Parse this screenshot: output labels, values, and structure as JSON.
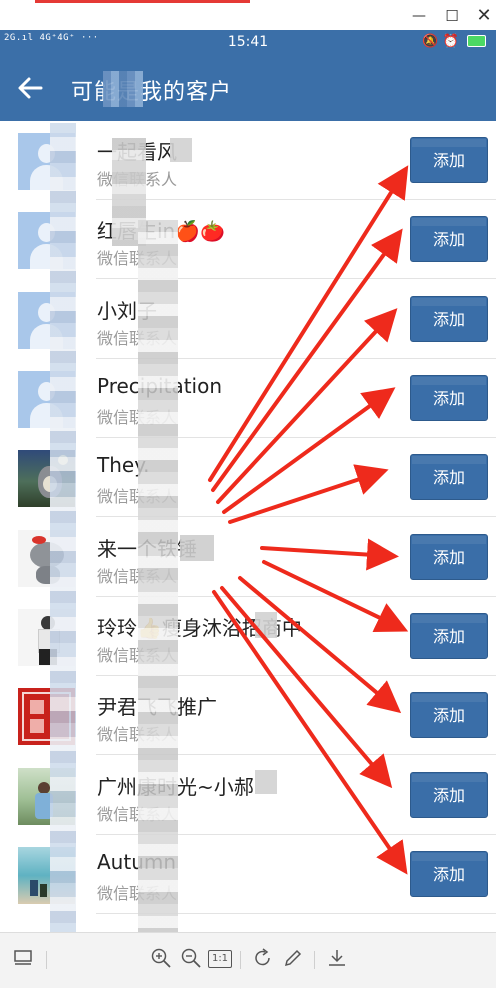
{
  "window": {
    "min_glyph": "—",
    "max_glyph": "☐",
    "close_glyph": "✕"
  },
  "status_bar": {
    "signal_text": "2G.ıl 4G⁺4G⁺ ···",
    "time": "15:41",
    "right_icons": "🔕 ⏰",
    "battery_level_percent": 90,
    "battery_color": "#4cd964"
  },
  "header": {
    "back_icon": "arrow-left-icon",
    "title": "可能是我的客户",
    "bg_color": "#3b6fa8"
  },
  "contacts": [
    {
      "name": "一起看风",
      "subtitle": "微信联系人",
      "button": "添加",
      "avatar": "default"
    },
    {
      "name": "红唇生in🍎🍅",
      "subtitle": "微信联系人",
      "button": "添加",
      "avatar": "default"
    },
    {
      "name": "小刘子",
      "subtitle": "微信联系人",
      "button": "添加",
      "avatar": "default"
    },
    {
      "name": "Precipitation",
      "subtitle": "微信联系人",
      "button": "添加",
      "avatar": "default"
    },
    {
      "name": "They.",
      "subtitle": "微信联系人",
      "button": "添加",
      "avatar": "photo-totoro"
    },
    {
      "name": "来一个铁锤",
      "subtitle": "微信联系人",
      "button": "添加",
      "avatar": "photo-cat"
    },
    {
      "name": "玲玲👍瘦身沐浴招商中",
      "subtitle": "微信联系人",
      "button": "添加",
      "avatar": "photo-person"
    },
    {
      "name": "尹君飞飞推广",
      "subtitle": "微信联系人",
      "button": "添加",
      "avatar": "photo-red-logo"
    },
    {
      "name": "广州康时光~小郝",
      "subtitle": "微信联系人",
      "button": "添加",
      "avatar": "photo-outdoor"
    },
    {
      "name": "Autumn",
      "subtitle": "微信联系人",
      "button": "添加",
      "avatar": "photo-beach"
    }
  ],
  "toolbar": {
    "items": [
      "screen-icon",
      "zoom-in-icon",
      "zoom-out-icon",
      "actual-size-icon",
      "rotate-icon",
      "edit-icon",
      "download-icon"
    ],
    "actual_size_label": "1:1"
  },
  "colors": {
    "button_bg": "#3a6ea8",
    "arrow": "#ee2a1c"
  }
}
